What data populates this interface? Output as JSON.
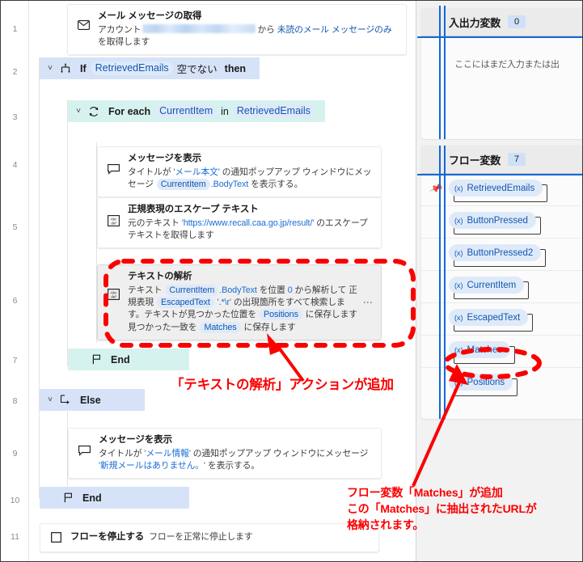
{
  "flow": {
    "gutter_numbers": [
      "1",
      "2",
      "3",
      "4",
      "5",
      "6",
      "7",
      "8",
      "9",
      "10",
      "11"
    ],
    "steps": [
      {
        "n": "1",
        "kind": "action",
        "icon": "envelope-icon",
        "title": "メール メッセージの取得",
        "desc_pre": "アカウント",
        "desc_mid": "から",
        "desc_link": "未読のメール メッセージのみ",
        "desc_post": "を取得します"
      },
      {
        "n": "2",
        "kind": "if",
        "icon": "branch-icon",
        "kw": "If",
        "token": "RetrievedEmails",
        "cond": "空でない",
        "then": "then"
      },
      {
        "n": "3",
        "kind": "foreach",
        "icon": "loop-icon",
        "kw": "For each",
        "token1": "CurrentItem",
        "in": "in",
        "token2": "RetrievedEmails"
      },
      {
        "n": "4",
        "kind": "action",
        "icon": "message-icon",
        "title": "メッセージを表示",
        "d1": "タイトルが",
        "d1_lit": "'メール本文'",
        "d2": "の通知ポップアップ ウィンドウにメッセージ",
        "d_tok": "CurrentItem",
        "d3": ".BodyText",
        "d4": "を表示する。"
      },
      {
        "n": "5",
        "kind": "action",
        "icon": "abcdef-icon",
        "title": "正規表現のエスケープ テキスト",
        "d1": "元のテキスト",
        "d1_lit": "'https://www.recall.caa.go.jp/result/'",
        "d2": "のエスケープ テキストを取得します"
      },
      {
        "n": "6",
        "kind": "action-selected",
        "icon": "abcdef-icon",
        "title": "テキストの解析",
        "l1_a": "テキスト",
        "l1_tok": "CurrentItem",
        "l1_b": ".BodyText",
        "l1_c": "を位置",
        "l1_num": "0",
        "l1_d": "から解析して",
        "l2_a": "正規表現",
        "l2_tok": "EscapedText",
        "l2_lit": "'.*\\r'",
        "l2_b": "の出現箇所をすべて検索します。",
        "l3_a": "テキストが見つかった位置を",
        "l3_tok": "Positions",
        "l3_b": "に保存します",
        "l4_a": "見つかった一致を",
        "l4_tok": "Matches",
        "l4_b": "に保存します",
        "overflow": "⋮"
      },
      {
        "n": "7",
        "kind": "end-for",
        "icon": "flag-icon",
        "label": "End"
      },
      {
        "n": "8",
        "kind": "else",
        "icon": "else-icon",
        "label": "Else"
      },
      {
        "n": "9",
        "kind": "action",
        "icon": "message-icon",
        "title": "メッセージを表示",
        "d1": "タイトルが",
        "d1_lit": "'メール情報'",
        "d2": "の通知ポップアップ ウィンドウにメッセージ",
        "d2_lit": "'新規メールはありません。'",
        "d3": "を表示する。"
      },
      {
        "n": "10",
        "kind": "end-if",
        "icon": "flag-icon",
        "label": "End"
      },
      {
        "n": "11",
        "kind": "action",
        "icon": "stop-icon",
        "title": "フローを停止する",
        "subtitle": "フローを正常に停止します"
      }
    ]
  },
  "variables_pane": {
    "io_panel": {
      "title": "入出力変数",
      "count": "0",
      "empty_message": "ここにはまだ入力または出"
    },
    "flow_panel": {
      "title": "フロー変数",
      "count": "7",
      "pin_icon": "pin-icon",
      "variables": [
        {
          "name": "RetrievedEmails",
          "prefix": "(x)",
          "pinned": true
        },
        {
          "name": "ButtonPressed",
          "prefix": "(x)",
          "pinned": false
        },
        {
          "name": "ButtonPressed2",
          "prefix": "(x)",
          "pinned": false
        },
        {
          "name": "CurrentItem",
          "prefix": "(x)",
          "pinned": false
        },
        {
          "name": "EscapedText",
          "prefix": "(x)",
          "pinned": false
        },
        {
          "name": "Matches",
          "prefix": "(x)",
          "pinned": false,
          "highlighted": true
        },
        {
          "name": "Positions",
          "prefix": "(x)",
          "pinned": false
        }
      ]
    }
  },
  "annotations": {
    "note_action": "「テキストの解析」アクションが追加",
    "note_variable_line1": "フロー変数「Matches」が追加",
    "note_variable_line2": "この「Matches」に抽出されたURLが",
    "note_variable_line3": "格納されます。"
  },
  "colors": {
    "annotation_red": "#fb0000",
    "token_blue_bg": "#dfeaf9",
    "token_blue_text": "#1257b0",
    "if_bar": "#d6e2f7",
    "foreach_bar": "#d6f2ef",
    "selected_row": "#efefef",
    "splitter_blue": "#1268d6"
  }
}
